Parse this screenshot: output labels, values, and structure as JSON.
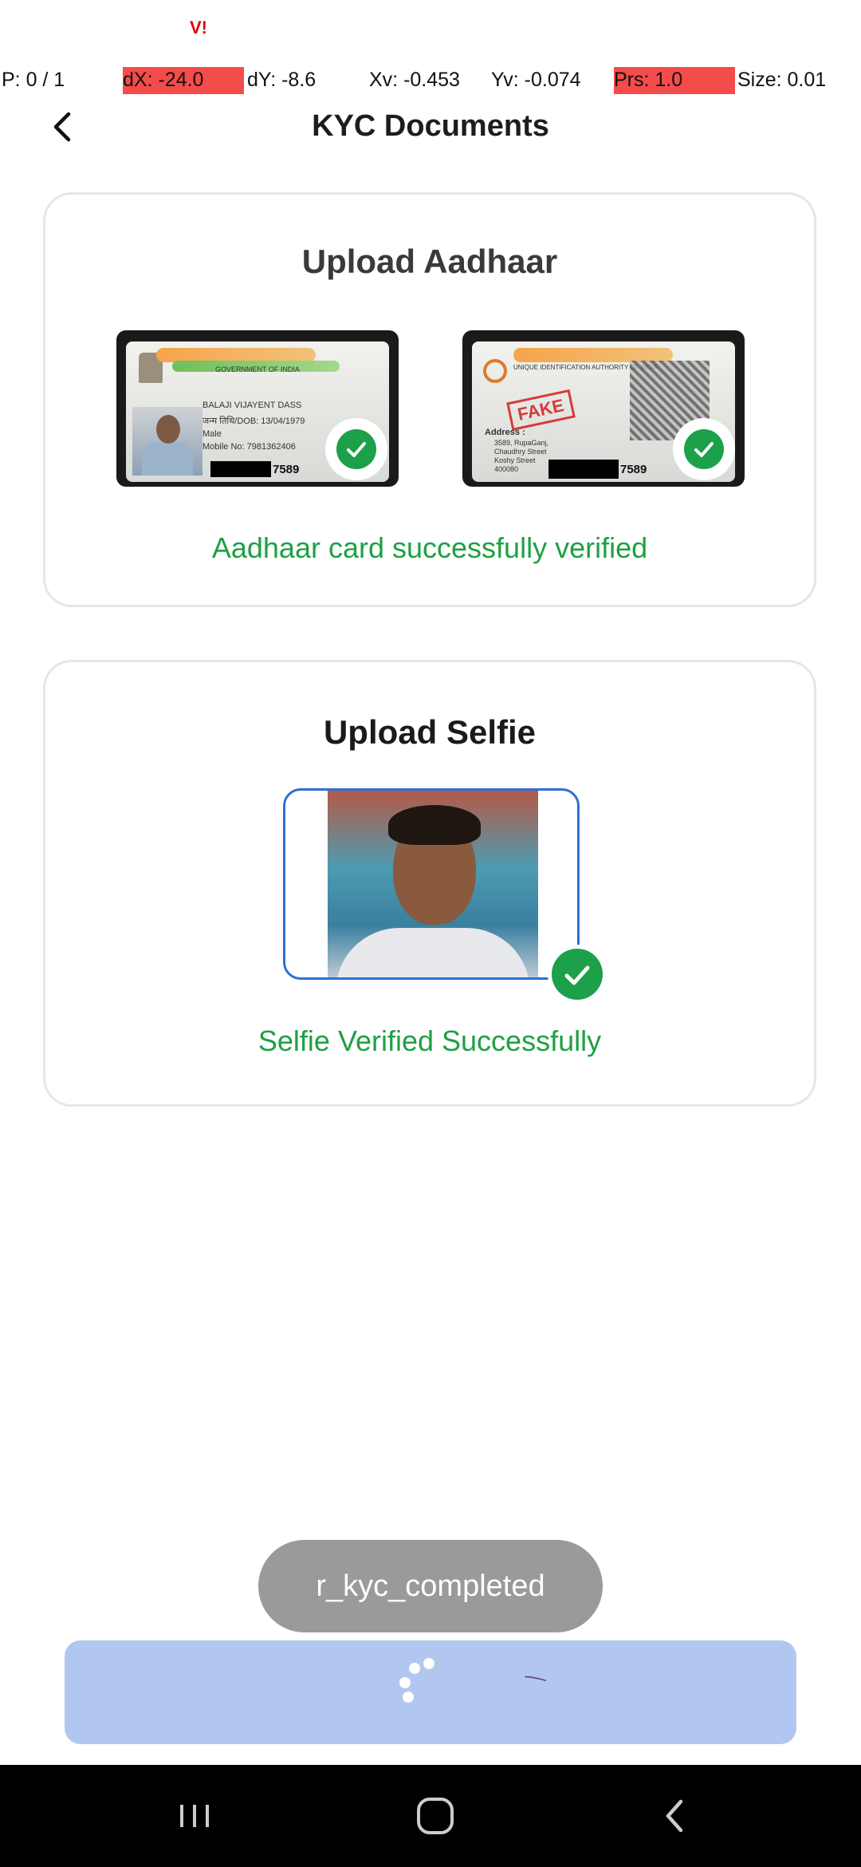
{
  "status_bar": {
    "carrier": "V!"
  },
  "pointer_overlay": {
    "p": "P: 0 / 1",
    "dx": "dX: -24.0",
    "dy": "dY: -8.6",
    "xv": "Xv: -0.453",
    "yv": "Yv: -0.074",
    "prs": "Prs: 1.0",
    "size": "Size: 0.01"
  },
  "header": {
    "title": "KYC Documents",
    "back_icon": "chevron-left-icon"
  },
  "aadhaar_card": {
    "title": "Upload Aadhaar",
    "front": {
      "govt": "GOVERNMENT OF INDIA",
      "name": "BALAJI VIJAYENT DASS",
      "dob": "जन्म तिथि/DOB: 13/04/1979",
      "gender": "Male",
      "mobile": "Mobile No: 7981362406",
      "number_tail": "7589"
    },
    "back": {
      "authority": "UNIQUE IDENTIFICATION AUTHORITY OF INDIA",
      "stamp": "FAKE",
      "address_label": "Address :",
      "address_line1": "3589, RupaGanj,",
      "address_line2": "Chaudhry Street",
      "address_line3": "Koshy Street",
      "address_line4": "400080",
      "number_tail": "7589"
    },
    "status": "Aadhaar card successfully verified"
  },
  "selfie_card": {
    "title": "Upload Selfie",
    "status": "Selfie Verified Successfully"
  },
  "toast": {
    "text": "r_kyc_completed"
  },
  "colors": {
    "success": "#1ea043",
    "check_green": "#1ca04a",
    "selfie_border": "#2f6fd6",
    "cta_bg": "#b1c7ef",
    "toast_bg": "#9a9a9a",
    "highlight_red": "#f44b4b"
  },
  "nav": {
    "recent": "recent-apps-icon",
    "home": "home-icon",
    "back": "back-icon"
  }
}
